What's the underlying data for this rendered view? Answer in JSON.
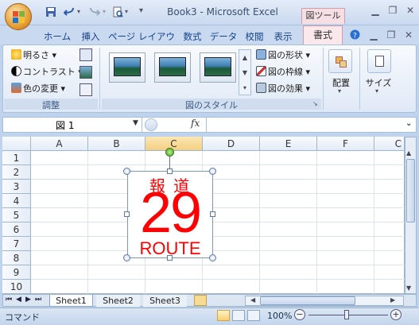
{
  "window": {
    "title": "Book3 - Microsoft Excel",
    "tool_tab_title": "図ツール"
  },
  "tabs": [
    "ホーム",
    "挿入",
    "ページ レイアウト",
    "数式",
    "データ",
    "校閲",
    "表示"
  ],
  "active_tab": "書式",
  "ribbon": {
    "adjust_group": {
      "label": "調整",
      "items": [
        "明るさ",
        "コントラスト",
        "色の変更"
      ]
    },
    "style_group": {
      "label": "図のスタイル",
      "items": [
        "図の形状",
        "図の枠線",
        "図の効果"
      ]
    },
    "arrange_label": "配置",
    "size_label": "サイズ"
  },
  "formula_bar": {
    "name_box": "図 1",
    "fx": "fx",
    "value": ""
  },
  "columns": [
    "A",
    "B",
    "C",
    "D",
    "E",
    "F",
    "C"
  ],
  "rows": [
    "1",
    "2",
    "3",
    "4",
    "5",
    "6",
    "7",
    "8",
    "9",
    "10"
  ],
  "shape": {
    "top_text": "報 道",
    "number": "29",
    "bottom_text": "ROUTE",
    "color": "#ff0000"
  },
  "sheet_tabs": [
    "Sheet1",
    "Sheet2",
    "Sheet3"
  ],
  "status": {
    "mode": "コマンド",
    "zoom": "100%"
  }
}
